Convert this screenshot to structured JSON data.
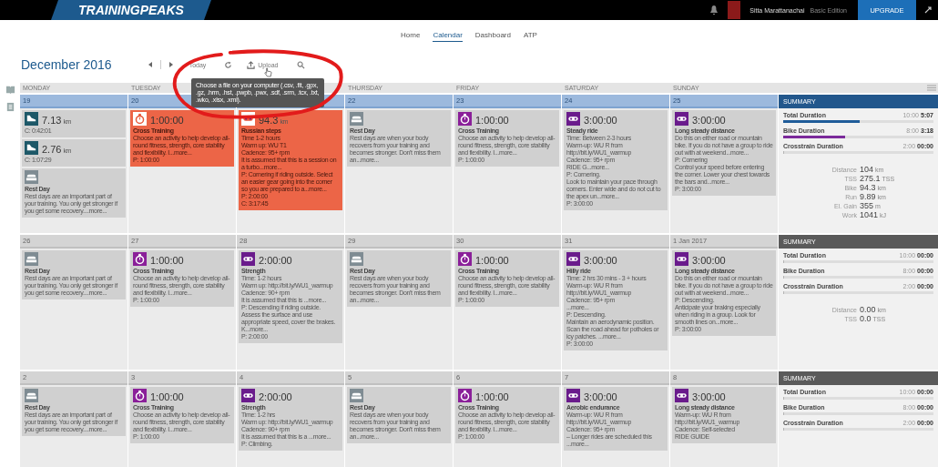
{
  "header": {
    "logo": "TRAININGPEAKS",
    "user_name": "Sitta Marattanachai",
    "edition": "Basic Edition",
    "upgrade": "UPGRADE"
  },
  "nav": [
    {
      "label": "Home",
      "selected": false
    },
    {
      "label": "Calendar",
      "selected": true
    },
    {
      "label": "Dashboard",
      "selected": false
    },
    {
      "label": "ATP",
      "selected": false
    }
  ],
  "toolbar": {
    "title": "December 2016",
    "today": "Today",
    "upload": "Upload"
  },
  "tooltip": "Choose a file on your computer (.csv, .fit, .gpx, .gz, .hrm, .hst, .pwpb, .pwx, .sdf, .srm, .tcx, .txt, .wko, .xlsx, .xml).",
  "day_names": [
    {
      "kind": "label",
      "text": "MONDAY"
    },
    {
      "kind": "label",
      "text": "TUESDAY"
    },
    {
      "kind": "covered"
    },
    {
      "kind": "label",
      "text": "THURSDAY"
    },
    {
      "kind": "label",
      "text": "FRIDAY"
    },
    {
      "kind": "label",
      "text": "SATURDAY"
    },
    {
      "kind": "label",
      "text": "SUNDAY"
    }
  ],
  "weeks": [
    {
      "current": true,
      "days": [
        {
          "date": "19",
          "workouts": [
            {
              "kind": "run",
              "missed": false,
              "value": "7.13",
              "unit": "km",
              "completed": "C: 0:42:01"
            },
            {
              "kind": "run",
              "missed": false,
              "value": "2.76",
              "unit": "km",
              "completed": "C: 1:07:29"
            },
            {
              "kind": "rest",
              "missed": false,
              "title": "Rest Day",
              "lines": [
                "Rest days are an important part of your training. You only get stronger if you get some recovery....more..."
              ]
            }
          ]
        },
        {
          "date": "20",
          "workouts": [
            {
              "kind": "cross",
              "missed": true,
              "value": "1:00:00",
              "title": "Cross Training",
              "lines": [
                "Choose an activity to help develop all-round fitness, strength, core stability and flexibility. I...more..."
              ],
              "planned": "P: 1:00:00"
            }
          ]
        },
        {
          "workouts": [
            {
              "kind": "bike",
              "missed": true,
              "value": "94.3",
              "unit": "km",
              "title": "Russian steps",
              "lines": [
                "Time 1-2 hours",
                "Warm up: WU T1",
                "Cadence: 95+ rpm",
                "It is assumed that this is a session on a turbo...more...",
                "P: Cornering if riding outside. Select an easier gear going into the corner so you are prepared to a...more..."
              ],
              "planned": "P: 2:00:00",
              "completed": "C: 3:17:45"
            }
          ]
        },
        {
          "date": "22",
          "workouts": [
            {
              "kind": "rest",
              "missed": false,
              "title": "Rest Day",
              "lines": [
                "Rest days are when your body recovers from your training and becomes stronger. Don't miss them an...more..."
              ]
            }
          ]
        },
        {
          "date": "23",
          "workouts": [
            {
              "kind": "cross",
              "missed": false,
              "value": "1:00:00",
              "title": "Cross Training",
              "lines": [
                "Choose an activity to help develop all-round fitness, strength, core stability and flexibility. I...more..."
              ],
              "planned": "P: 1:00:00"
            }
          ]
        },
        {
          "date": "24",
          "workouts": [
            {
              "kind": "bike",
              "missed": false,
              "value": "3:00:00",
              "title": "Steady ride",
              "lines": [
                "Time: Between 2-3 hours",
                "Warm-up: WU R from http://bit.ly/WU1_warmup",
                "Cadence: 95+ rpm",
                "RIDE G...more...",
                "P: Cornering.",
                "Look to maintain your pace through corners. Enter wide and do not cut to the apex un...more..."
              ],
              "planned": "P: 3:00:00"
            }
          ]
        },
        {
          "date": "25",
          "workouts": [
            {
              "kind": "bike",
              "missed": false,
              "value": "3:00:00",
              "title": "Long steady distance",
              "lines": [
                "Do this on either road or mountain bike. If you do not have a group to ride out with at weekend...more...",
                "P: Cornering",
                "Control your speed before entering the corner. Lower your chest towards the bars and...more..."
              ],
              "planned": "P: 3:00:00"
            }
          ]
        }
      ],
      "summary": {
        "title": "SUMMARY",
        "bars": [
          {
            "label": "Total Duration",
            "planned": "10:00",
            "actual": "5:07",
            "level": 0.51,
            "color": "#1f5c99"
          },
          {
            "label": "Bike Duration",
            "planned": "8:00",
            "actual": "3:18",
            "level": 0.41,
            "color": "#7b2a9b"
          },
          {
            "label": "Crosstrain Duration",
            "planned": "2:00",
            "actual": "00:00",
            "level": 0
          }
        ],
        "stats": [
          {
            "label": "Distance",
            "value": "104",
            "unit": "km"
          },
          {
            "label": "TSS",
            "value": "275.1",
            "unit": "TSS"
          },
          {
            "label": "Bike",
            "value": "94.3",
            "unit": "km"
          },
          {
            "label": "Run",
            "value": "9.89",
            "unit": "km"
          },
          {
            "label": "El. Gain",
            "value": "355",
            "unit": "m"
          },
          {
            "label": "Work",
            "value": "1041",
            "unit": "kJ"
          }
        ]
      }
    },
    {
      "current": false,
      "days": [
        {
          "date": "26",
          "workouts": [
            {
              "kind": "rest",
              "missed": false,
              "title": "Rest Day",
              "lines": [
                "Rest days are an important part of your training. You only get stronger if you get some recovery....more..."
              ]
            }
          ]
        },
        {
          "date": "27",
          "workouts": [
            {
              "kind": "cross",
              "missed": false,
              "value": "1:00:00",
              "title": "Cross Training",
              "lines": [
                "Choose an activity to help develop all-round fitness, strength, core stability and flexibility. I...more..."
              ],
              "planned": "P: 1:00:00"
            }
          ]
        },
        {
          "date": "28",
          "workouts": [
            {
              "kind": "bike",
              "missed": false,
              "value": "2:00:00",
              "title": "Strength",
              "lines": [
                "Time: 1-2 hours",
                "Warm up: http://bit.ly/WU1_warmup",
                "Cadence: 90+ rpm",
                "It is assumed that this is ...more...",
                "P: Descending if riding outside. Assess the surface and use appropriate speed, cover the brakes. K...more..."
              ],
              "planned": "P: 2:00:00"
            }
          ]
        },
        {
          "date": "29",
          "workouts": [
            {
              "kind": "rest",
              "missed": false,
              "title": "Rest Day",
              "lines": [
                "Rest days are when your body recovers from your training and becomes stronger. Don't miss them an...more..."
              ]
            }
          ]
        },
        {
          "date": "30",
          "workouts": [
            {
              "kind": "cross",
              "missed": false,
              "value": "1:00:00",
              "title": "Cross Training",
              "lines": [
                "Choose an activity to help develop all-round fitness, strength, core stability and flexibility. I...more..."
              ],
              "planned": "P: 1:00:00"
            }
          ]
        },
        {
          "date": "31",
          "workouts": [
            {
              "kind": "bike",
              "missed": false,
              "value": "3:00:00",
              "title": "Hilly ride",
              "lines": [
                "Time: 2 hrs 30 mins - 3 + hours",
                "Warm-up: WU R from http://bit.ly/WU1_warmup",
                "Cadence: 95+ rpm",
                "...more...",
                "P: Descending.",
                "Maintain an aerodynamic position. Scan the road ahead for potholes or icy patches. ...more..."
              ],
              "planned": "P: 3:00:00"
            }
          ]
        },
        {
          "date": "1 Jan 2017",
          "workouts": [
            {
              "kind": "bike",
              "missed": false,
              "value": "3:00:00",
              "title": "Long steady distance",
              "lines": [
                "Do this on either road or mountain bike. If you do not have a group to ride out with at weekend...more...",
                "P: Descending.",
                "Anticipate your braking especially when riding in a group. Look for smooth lines on...more..."
              ],
              "planned": "P: 3:00:00"
            }
          ]
        }
      ],
      "summary": {
        "title": "SUMMARY",
        "bars": [
          {
            "label": "Total Duration",
            "planned": "10:00",
            "actual": "00:00",
            "level": 0
          },
          {
            "label": "Bike Duration",
            "planned": "8:00",
            "actual": "00:00",
            "level": 0
          },
          {
            "label": "Crosstrain Duration",
            "planned": "2:00",
            "actual": "00:00",
            "level": 0
          }
        ],
        "stats": [
          {
            "label": "Distance",
            "value": "0.00",
            "unit": "km"
          },
          {
            "label": "TSS",
            "value": "0.0",
            "unit": "TSS"
          }
        ]
      }
    },
    {
      "current": false,
      "days": [
        {
          "date": "2",
          "workouts": [
            {
              "kind": "rest",
              "missed": false,
              "title": "Rest Day",
              "lines": [
                "Rest days are an important part of your training. You only get stronger if you get some recovery....more..."
              ]
            }
          ]
        },
        {
          "date": "3",
          "workouts": [
            {
              "kind": "cross",
              "missed": false,
              "value": "1:00:00",
              "title": "Cross Training",
              "lines": [
                "Choose an activity to help develop all-round fitness, strength, core stability and flexibility. I...more..."
              ],
              "planned": "P: 1:00:00"
            }
          ]
        },
        {
          "date": "4",
          "workouts": [
            {
              "kind": "bike",
              "missed": false,
              "value": "2:00:00",
              "title": "Strength",
              "lines": [
                "Time: 1-2 hrs",
                "Warm up: http://bit.ly/WU1_warmup",
                "Cadence: 90+ rpm",
                "It is assumed that this is a ...more...",
                "P: Climbing."
              ]
            }
          ]
        },
        {
          "date": "5",
          "workouts": [
            {
              "kind": "rest",
              "missed": false,
              "title": "Rest Day",
              "lines": [
                "Rest days are when your body recovers from your training and becomes stronger. Don't miss them an...more..."
              ]
            }
          ]
        },
        {
          "date": "6",
          "workouts": [
            {
              "kind": "cross",
              "missed": false,
              "value": "1:00:00",
              "title": "Cross Training",
              "lines": [
                "Choose an activity to help develop all-round fitness, strength, core stability and flexibility. I...more..."
              ],
              "planned": "P: 1:00:00"
            }
          ]
        },
        {
          "date": "7",
          "workouts": [
            {
              "kind": "bike",
              "missed": false,
              "value": "3:00:00",
              "title": "Aerobic endurance",
              "lines": [
                "Warm-up: WU R from http://bit.ly/WU1_warmup",
                "Cadence: 95+ rpm",
                "– Longer rides are scheduled this ...more..."
              ]
            }
          ]
        },
        {
          "date": "8",
          "workouts": [
            {
              "kind": "bike",
              "missed": false,
              "value": "3:00:00",
              "title": "Long steady distance",
              "lines": [
                "Warm-up: WU R from http://bit.ly/WU1_warmup",
                "Cadence: Self-selected",
                "RIDE GUIDE"
              ]
            }
          ]
        }
      ],
      "summary": {
        "title": "SUMMARY",
        "bars": [
          {
            "label": "Total Duration",
            "planned": "10:00",
            "actual": "00:00",
            "level": 0
          },
          {
            "label": "Bike Duration",
            "planned": "8:00",
            "actual": "00:00",
            "level": 0
          },
          {
            "label": "Crosstrain Duration",
            "planned": "2:00",
            "actual": "00:00",
            "level": 0
          }
        ]
      }
    }
  ]
}
